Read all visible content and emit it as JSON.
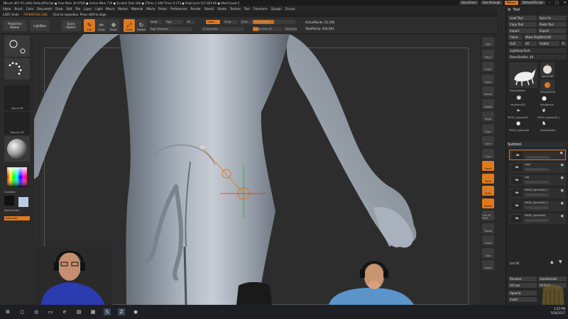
{
  "titlebar": {
    "text": "ZBrush 4R7 P3 (x64)   DefaultZScript ● Free Mem 34.97GB ● Active Mem 719 ● Scratch Disk 184 ● ZTime 1.149 Timer 0.173 ● PolyCount 527.824 KP ● MeshCount 5",
    "quicksave": "QuickSave",
    "seethrough": "See-through",
    "menus": "Menus",
    "defaultzscript": "DefaultZScript"
  },
  "menubar": [
    "Alpha",
    "Brush",
    "Color",
    "Document",
    "Draw",
    "Edit",
    "File",
    "Layer",
    "Light",
    "Macro",
    "Marker",
    "Material",
    "Movie",
    "Picker",
    "Preferences",
    "Render",
    "Stencil",
    "Stroke",
    "Texture",
    "Tool",
    "Transform",
    "Zplugin",
    "Zscript"
  ],
  "infobar": {
    "left": "LAZY: Undo",
    "message": "TRANSPOSE LINE:",
    "hint": "Click to reposition. Press shift to align."
  },
  "shelf": {
    "projection_master": "Projection\nMaster",
    "lightbox": "LightBox",
    "quick_sketch": "Quick\nSketch",
    "edit": "Edit",
    "draw": "Draw",
    "move": "Move",
    "scale": "Scale",
    "rotate": "Rotate",
    "mrgb": "Mrgb",
    "rgb": "Rgb",
    "m": "M",
    "zadd": "Zadd",
    "zsub": "Zsub",
    "zcut": "Zcut",
    "rgb_intensity": "Rgb Intensity",
    "z_intensity": "Z Intensity",
    "focal_shift": "Focal Shift 0",
    "draw_size": "Draw Size 15",
    "dynamic": "Dynamic",
    "active_points": "ActivePoints: 52,546",
    "total_points": "TotalPoints: 934,091"
  },
  "leftpanel": {
    "alpha_off": "Alpha Off",
    "texture_off": "Texture Off",
    "gradient": "Gradient",
    "switchcolor": "SwitchColor",
    "alternate": "Alternate"
  },
  "rightcol": [
    "BPR",
    "SPix 3",
    "Scroll",
    "Zoom",
    "Actual",
    "AAHalf",
    "Persp",
    "Floor",
    "Local",
    "L.Sym",
    "Frame",
    "Move",
    "Scale",
    "Rotate",
    "Line Fill PolyF",
    "Transp",
    "Ghost",
    "Solo",
    "Xpose"
  ],
  "toolpanel": {
    "title": "Tool",
    "load_tool": "Load Tool",
    "save_as": "Save As",
    "copy_tool": "Copy Tool",
    "paste_tool": "Paste Tool",
    "import": "Import",
    "export": "Export",
    "clone": "Clone",
    "make_polymesh3d": "Make PolyMesh3D",
    "goz": "GoZ",
    "all": "All",
    "visible": "Visible",
    "r": "R",
    "lightbox_tools": "Lightbox▸Tools",
    "current_tool": "DemoSoldier. 48",
    "thumbs": [
      "DemoSoldier",
      "Sphere3D",
      "SimpleBrush",
      "PolyMesh3D",
      "PolySphere",
      "PM3D_Sphere3D",
      "PM3D_Sphere3D_1",
      "PM3D_Sphere3D",
      "DemoSoldier"
    ],
    "subtool_title": "Subtool",
    "subtools": [
      "",
      "Leg1",
      "Leg",
      "PM3D_Sphere3D_1",
      "PM3D_Sphere3D_2",
      "PM3D_Sphere3D"
    ],
    "list_all": "List All",
    "rename": "Rename",
    "autoreorder": "AutoReorder",
    "all_low": "All Low",
    "all_high": "All High",
    "append": "Append",
    "insert": "Insert"
  },
  "clock": {
    "time": "1:22 PM",
    "date": "5/18/2017"
  },
  "icons": [
    "windows-start-icon",
    "search-icon",
    "cortana-icon",
    "task-view-icon",
    "edge-icon",
    "file-explorer-icon",
    "store-icon",
    "skype-icon",
    "zbrush-icon",
    "chrome-icon"
  ],
  "colors": {
    "accent": "#e07a1f",
    "background": "#2d2d2d",
    "panel": "#262626"
  }
}
